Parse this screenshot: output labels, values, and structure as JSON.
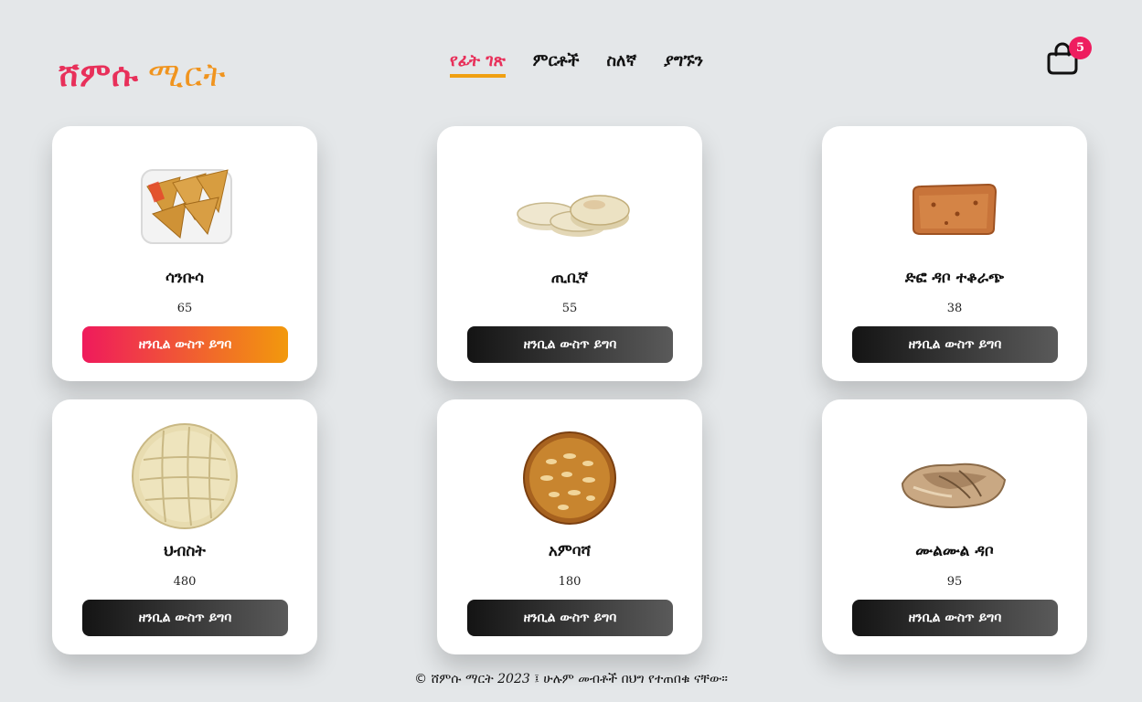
{
  "brand": {
    "part1": "ሸምሱ",
    "part2": "ሚርት",
    "color1": "#e8305a",
    "color2": "#f0941e"
  },
  "nav": {
    "items": [
      {
        "label": "የፊት ገጽ",
        "active": true
      },
      {
        "label": "ምርቶች",
        "active": false
      },
      {
        "label": "ስለኛ",
        "active": false
      },
      {
        "label": "ያግኙን",
        "active": false
      }
    ]
  },
  "cart": {
    "icon": "shopping-bag-icon",
    "count": "5"
  },
  "products": [
    {
      "name": "ሳንቡሳ",
      "price": "65",
      "button": "ዘንቢል ውስጥ ይግባ",
      "image": "sambusa-image"
    },
    {
      "name": "ጢቢኛ",
      "price": "55",
      "button": "ዘንቢል ውስጥ ይግባ",
      "image": "tibiña-image"
    },
    {
      "name": "ድፎ ዳቦ ተቆራጭ",
      "price": "38",
      "button": "ዘንቢል ውስጥ ይግባ",
      "image": "difo-dabo-image"
    },
    {
      "name": "ህብስት",
      "price": "480",
      "button": "ዘንቢል ውስጥ ይግባ",
      "image": "hibist-image"
    },
    {
      "name": "አምባሻ",
      "price": "180",
      "button": "ዘንቢል ውስጥ ይግባ",
      "image": "ambasha-image"
    },
    {
      "name": "ሙልሙል ዳቦ",
      "price": "95",
      "button": "ዘንቢል ውስጥ ይግባ",
      "image": "mulmul-dabo-image"
    }
  ],
  "footer": {
    "prefix": "© ሸምሱ ማርት",
    "year": "2023",
    "suffix": "፤ ሁሉም መብቶች በህግ የተጠበቁ ናቸው።"
  },
  "colors": {
    "accent": "#ee1d5f",
    "underline": "#f0a012",
    "background": "#e4e7e9"
  }
}
